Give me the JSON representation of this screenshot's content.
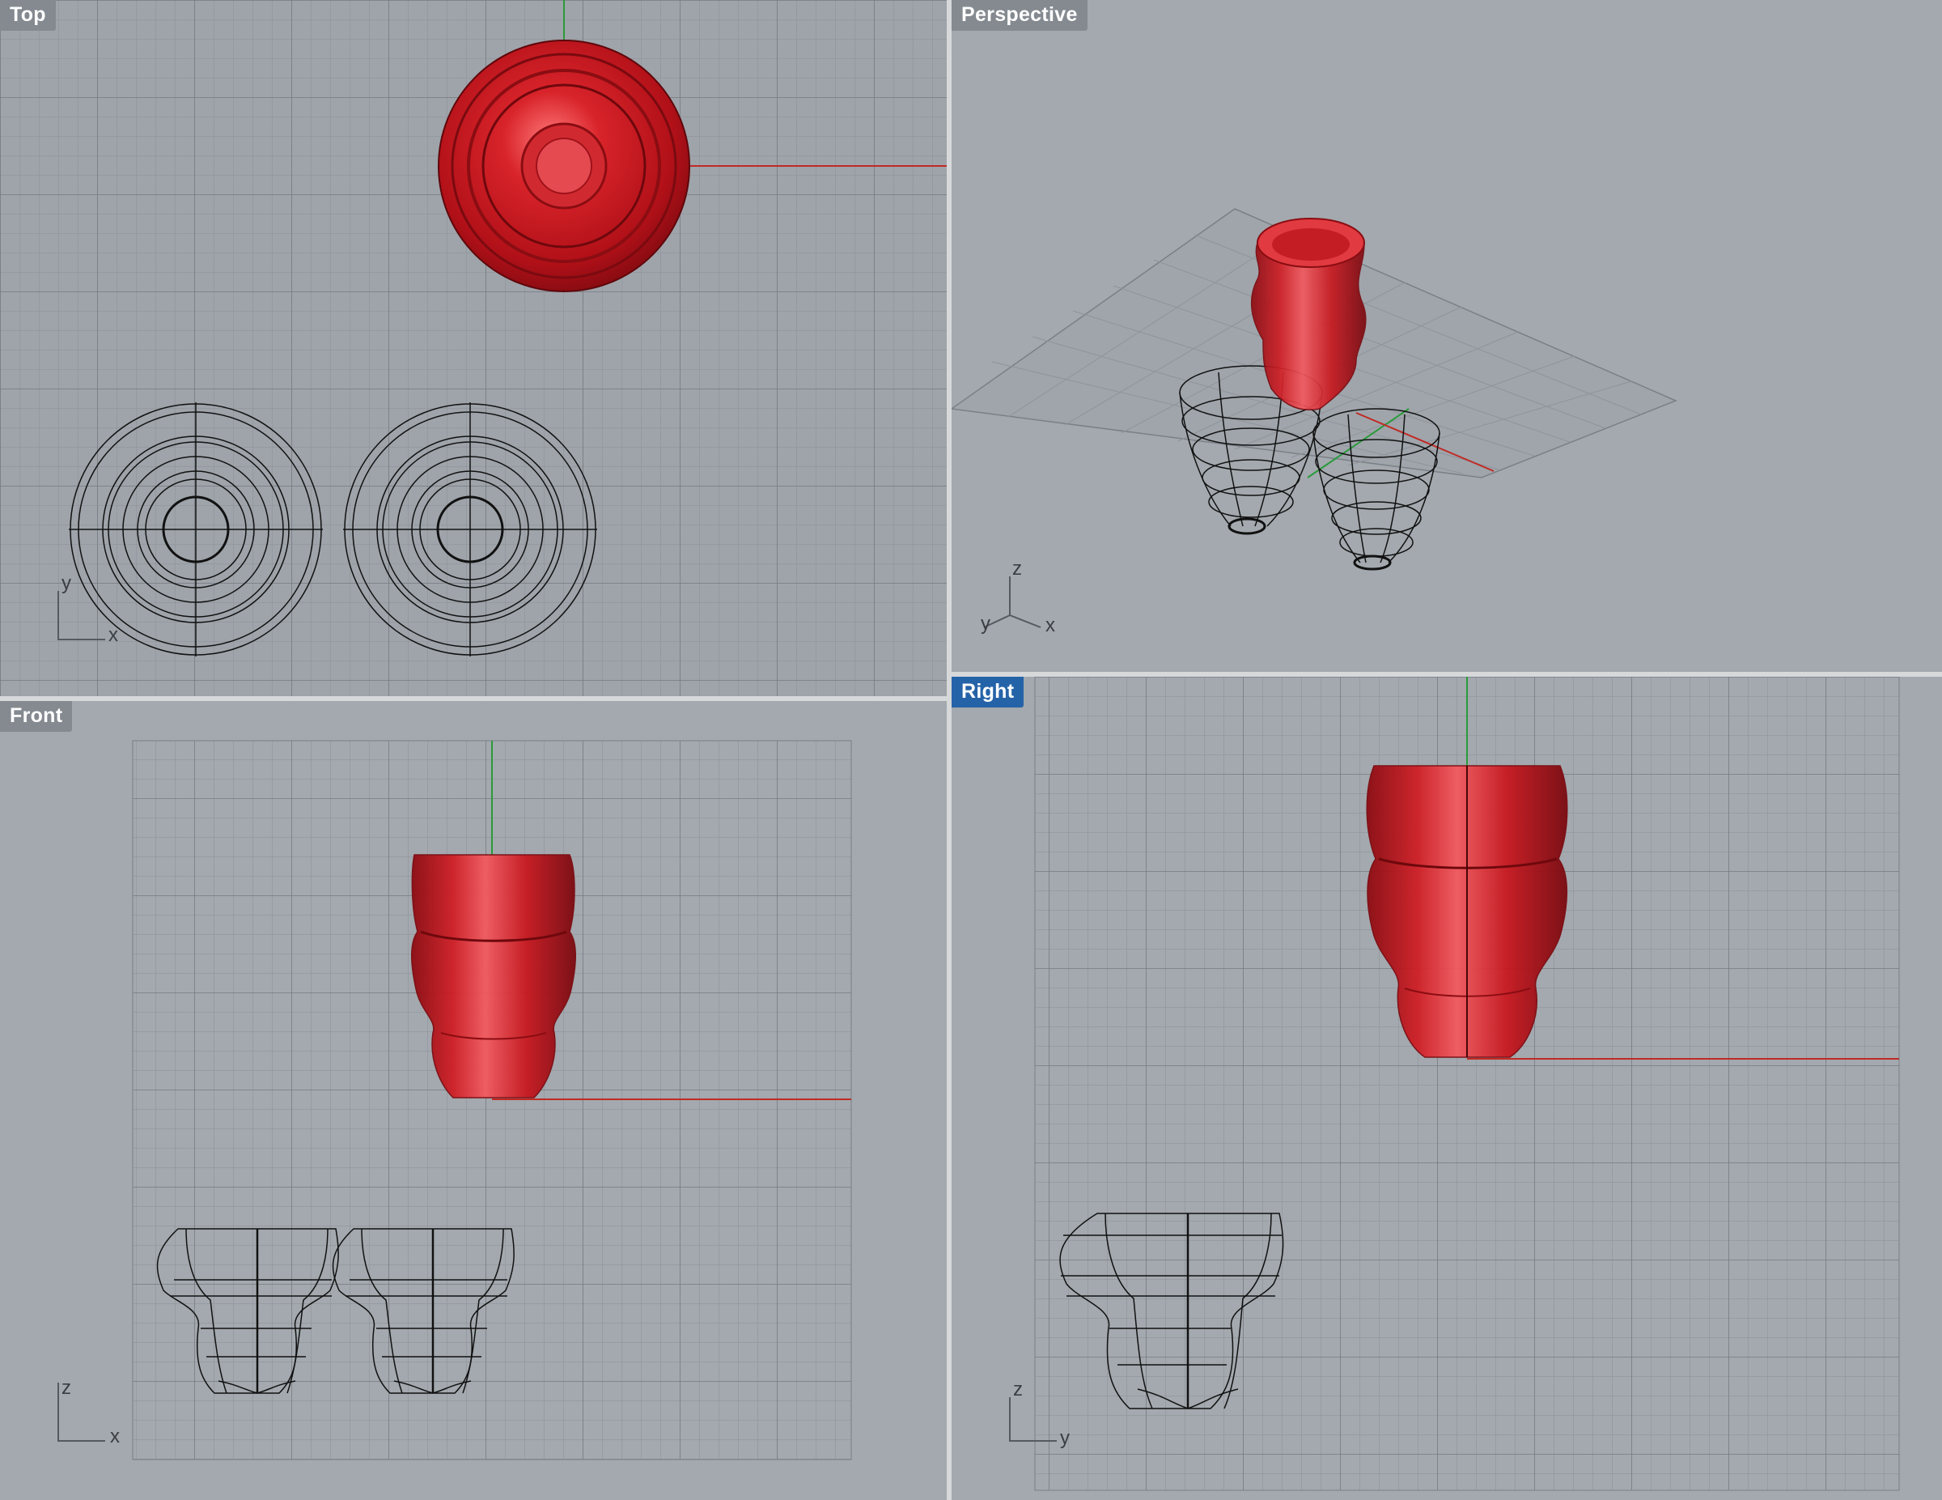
{
  "colors": {
    "viewport_bg": "#9ea4aa",
    "active_label": "#2563a8",
    "object_red": "#c4151c",
    "x_axis": "#c12a24",
    "y_axis": "#2a9a3a"
  },
  "viewports": {
    "top": {
      "label": "Top",
      "active": false,
      "axes": [
        "y",
        "x"
      ]
    },
    "perspective": {
      "label": "Perspective",
      "active": false,
      "axes": [
        "z",
        "y",
        "x"
      ]
    },
    "front": {
      "label": "Front",
      "active": false,
      "axes": [
        "z",
        "x"
      ]
    },
    "right": {
      "label": "Right",
      "active": true,
      "axes": [
        "z",
        "y"
      ]
    }
  }
}
